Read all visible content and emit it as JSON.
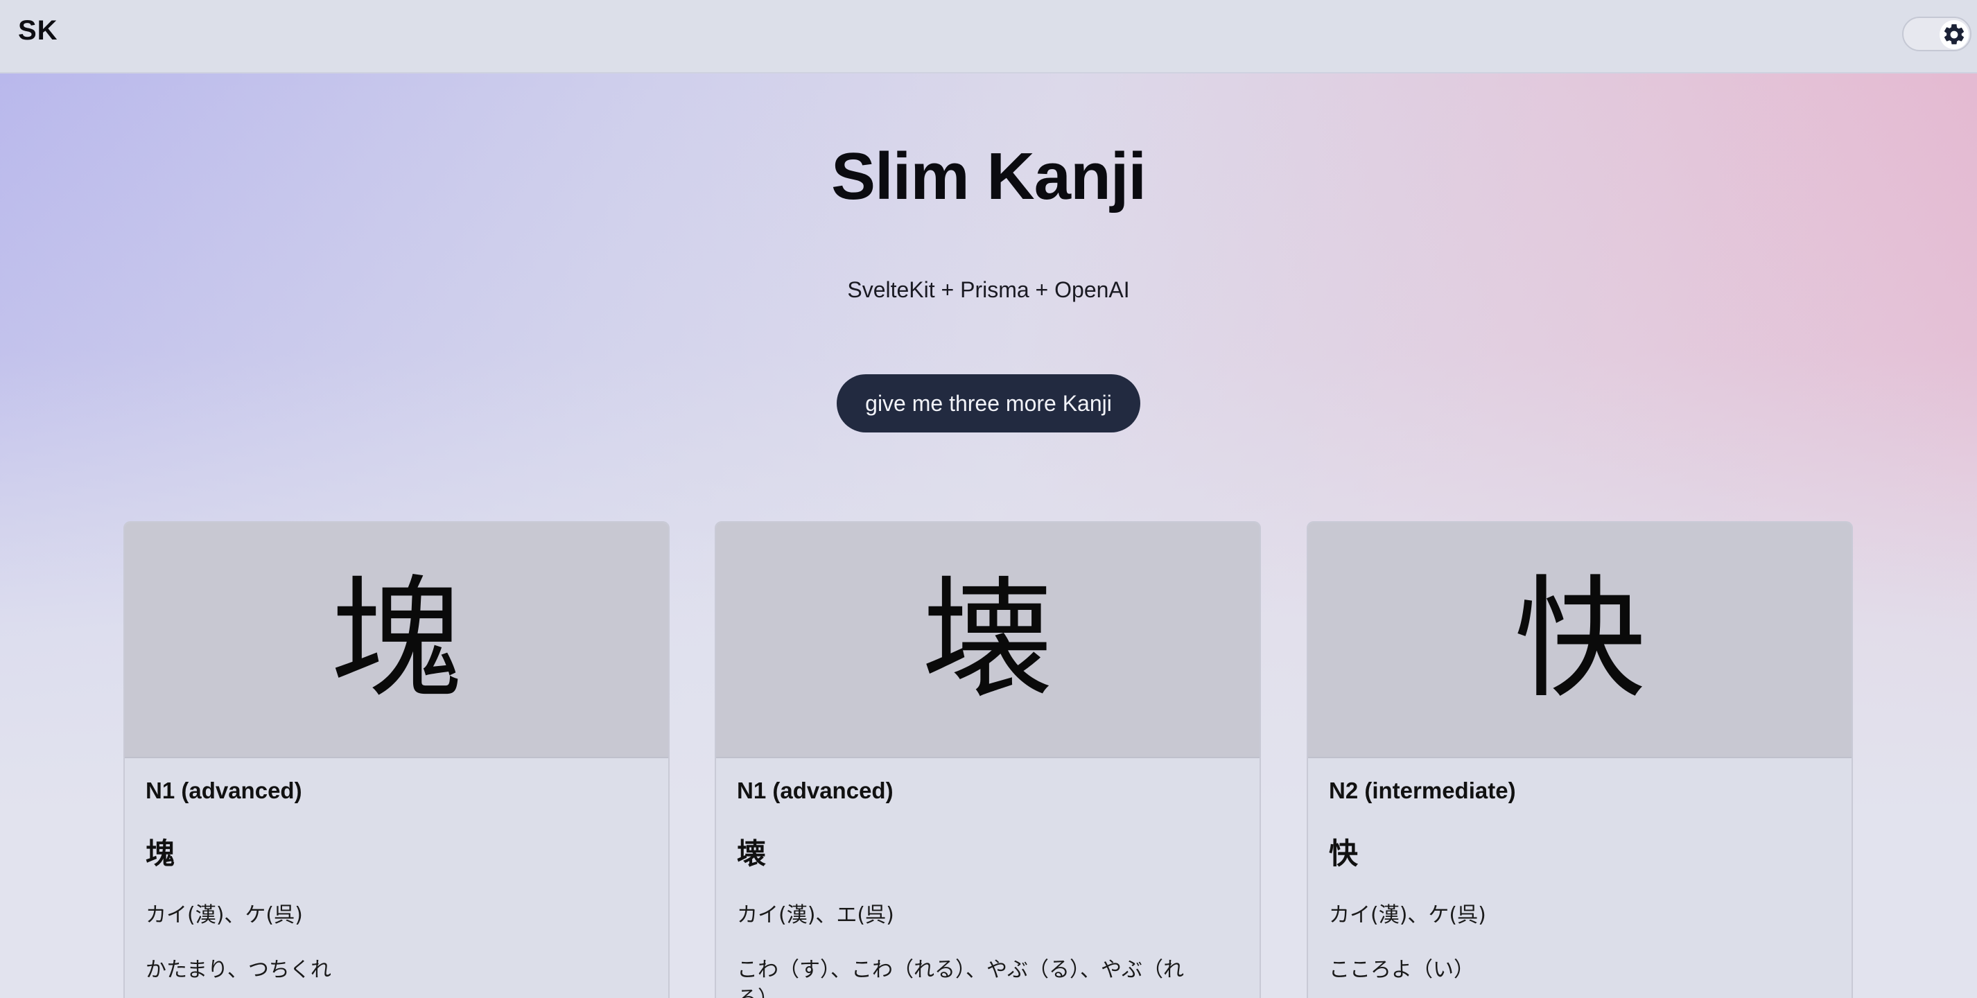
{
  "app": {
    "logo": "SK",
    "title": "Slim Kanji",
    "subtitle": "SvelteKit + Prisma + OpenAI",
    "cta_label": "give me three more Kanji"
  },
  "theme_toggle": {
    "icon": "gear-icon"
  },
  "cards": [
    {
      "kanji": "塊",
      "level": "N1 (advanced)",
      "onyomi": "カイ(漢)、ケ(呉)",
      "kunyomi": "かたまり、つちくれ"
    },
    {
      "kanji": "壊",
      "level": "N1 (advanced)",
      "onyomi": "カイ(漢)、エ(呉)",
      "kunyomi": "こわ（す）、こわ（れる）、やぶ（る）、やぶ（れる）"
    },
    {
      "kanji": "快",
      "level": "N2 (intermediate)",
      "onyomi": "カイ(漢)、ケ(呉)",
      "kunyomi": "こころよ（い）"
    }
  ],
  "colors": {
    "cta_background": "#222a40",
    "gradient_left": "#b9b8ec",
    "gradient_right": "#e5b3cd"
  }
}
